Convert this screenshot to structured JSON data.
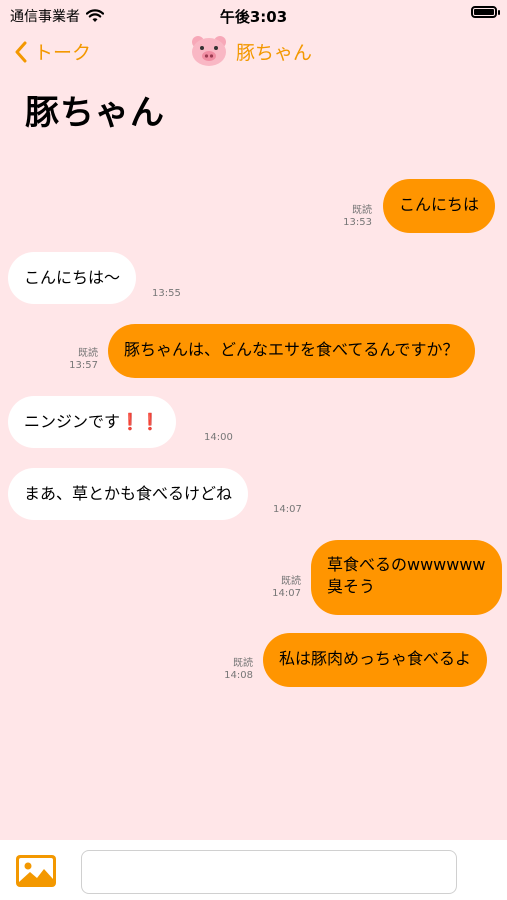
{
  "status": {
    "carrier": "通信事業者",
    "time": "午後3:03"
  },
  "nav": {
    "back_label": "トーク",
    "contact_name": "豚ちゃん"
  },
  "title": "豚ちゃん",
  "messages": [
    {
      "from": "me",
      "text": "こんにちは",
      "read": "既読",
      "time": "13:53"
    },
    {
      "from": "them",
      "text": "こんにちは〜",
      "time": "13:55"
    },
    {
      "from": "me",
      "text": "豚ちゃんは、どんなエサを食べてるんですか？",
      "read": "既読",
      "time": "13:57"
    },
    {
      "from": "them",
      "text": "ニンジンです",
      "emoji": "❗❗",
      "time": "14:00"
    },
    {
      "from": "them",
      "text": "まあ、草とかも食べるけどね",
      "time": "14:07"
    },
    {
      "from": "me",
      "line1": "草食べるのwwwwww",
      "line2": "臭そう",
      "read": "既読",
      "time": "14:07"
    },
    {
      "from": "me",
      "text": "私は豚肉めっちゃ食べるよ",
      "read": "既読",
      "time": "14:08"
    }
  ],
  "input": {
    "placeholder": ""
  },
  "colors": {
    "background": "#FFE6E8",
    "accent": "#F39800",
    "my_bubble": "#FF9500",
    "their_bubble": "#FFFFFF"
  },
  "icons": [
    "wifi-icon",
    "battery-icon",
    "back-chevron-icon",
    "pig-avatar-icon",
    "photo-icon"
  ]
}
